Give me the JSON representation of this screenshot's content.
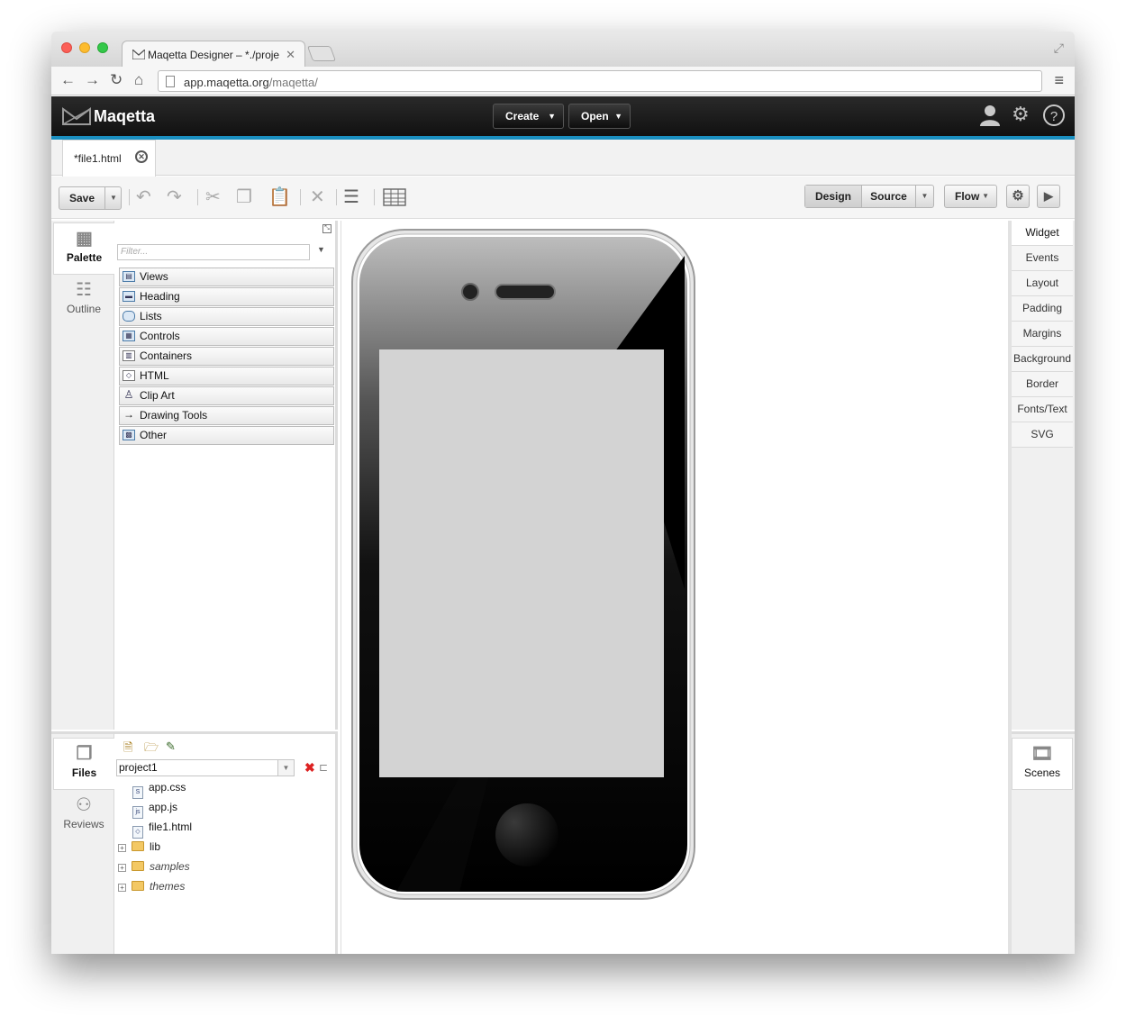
{
  "browser": {
    "tab_title": "Maqetta Designer – *./proje",
    "url_host": "app.maqetta.org",
    "url_path": "/maqetta/"
  },
  "app": {
    "name": "Maqetta",
    "create_label": "Create",
    "open_label": "Open"
  },
  "document_tab": {
    "label": "*file1.html"
  },
  "toolbar": {
    "save_label": "Save",
    "design_label": "Design",
    "source_label": "Source",
    "flow_label": "Flow"
  },
  "left_rail": {
    "palette_label": "Palette",
    "outline_label": "Outline"
  },
  "palette": {
    "filter_placeholder": "Filter...",
    "items": [
      {
        "label": "Views",
        "icon": "views-icon"
      },
      {
        "label": "Heading",
        "icon": "heading-icon"
      },
      {
        "label": "Lists",
        "icon": "lists-icon"
      },
      {
        "label": "Controls",
        "icon": "controls-icon"
      },
      {
        "label": "Containers",
        "icon": "containers-icon"
      },
      {
        "label": "HTML",
        "icon": "html-icon"
      },
      {
        "label": "Clip Art",
        "icon": "clip-art-icon"
      },
      {
        "label": "Drawing Tools",
        "icon": "drawing-tools-icon"
      },
      {
        "label": "Other",
        "icon": "other-icon"
      }
    ]
  },
  "bottom_rail": {
    "files_label": "Files",
    "reviews_label": "Reviews"
  },
  "files": {
    "project": "project1",
    "tree": [
      {
        "name": "app.css",
        "kind": "file"
      },
      {
        "name": "app.js",
        "kind": "file"
      },
      {
        "name": "file1.html",
        "kind": "file"
      },
      {
        "name": "lib",
        "kind": "folder"
      },
      {
        "name": "samples",
        "kind": "folder-italic"
      },
      {
        "name": "themes",
        "kind": "folder-italic"
      }
    ]
  },
  "properties": {
    "tabs": [
      "Widget",
      "Events",
      "Layout",
      "Padding",
      "Margins",
      "Background",
      "Border",
      "Fonts/Text",
      "SVG"
    ]
  },
  "scenes": {
    "label": "Scenes"
  },
  "colors": {
    "accent": "#1a8fc0",
    "header_bg": "#111111",
    "canvas_screen": "#d3d3d3"
  }
}
